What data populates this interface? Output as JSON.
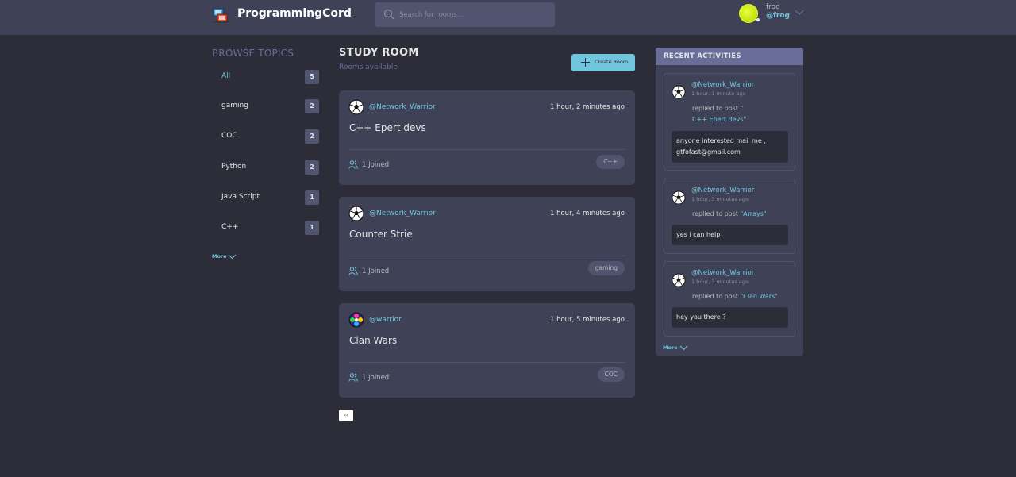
{
  "header": {
    "brand": "ProgrammingCord",
    "search_placeholder": "Search for rooms...",
    "user_name": "frog",
    "user_handle": "@frog"
  },
  "sidebar": {
    "title": "BROWSE TOPICS",
    "topics": [
      {
        "label": "All",
        "count": "5"
      },
      {
        "label": "gaming",
        "count": "2"
      },
      {
        "label": "COC",
        "count": "2"
      },
      {
        "label": "Python",
        "count": "2"
      },
      {
        "label": "Java Script",
        "count": "1"
      },
      {
        "label": "C++",
        "count": "1"
      }
    ],
    "more": "More"
  },
  "main": {
    "title": "STUDY ROOM",
    "subtitle": "Rooms available",
    "create_label": "Create Room",
    "rooms": [
      {
        "host": "@Network_Warrior",
        "time": "1 hour, 2 minutes ago",
        "title": "C++ Epert devs",
        "joined": "1 Joined",
        "tag": "C++"
      },
      {
        "host": "@Network_Warrior",
        "time": "1 hour, 4 minutes ago",
        "title": "Counter Strie",
        "joined": "1 Joined",
        "tag": "gaming"
      },
      {
        "host": "@warrior",
        "time": "1 hour, 5 minutes ago",
        "title": "Clan Wars",
        "joined": "1 Joined",
        "tag": "COC"
      }
    ],
    "page_label": "‹‹"
  },
  "activity": {
    "title": "RECENT ACTIVITIES",
    "items": [
      {
        "user": "@Network_Warrior",
        "time": "1 hour, 1 minute ago",
        "action": "replied to post \"",
        "post": "C++ Epert devs\"",
        "message": "anyone interested mail me , gtfofast@gmail.com"
      },
      {
        "user": "@Network_Warrior",
        "time": "1 hour, 3 minutes ago",
        "action": "replied to post ",
        "post": "\"Arrays\"",
        "message": "yes i can help"
      },
      {
        "user": "@Network_Warrior",
        "time": "1 hour, 3 minutes ago",
        "action": "replied to post ",
        "post": "\"Clan Wars\"",
        "message": "hey you there ?"
      }
    ],
    "more": "More"
  },
  "colors": {
    "background": "#2d2d39",
    "panel": "#3f4156",
    "accent": "#71c6dd",
    "muted": "#696d97"
  }
}
